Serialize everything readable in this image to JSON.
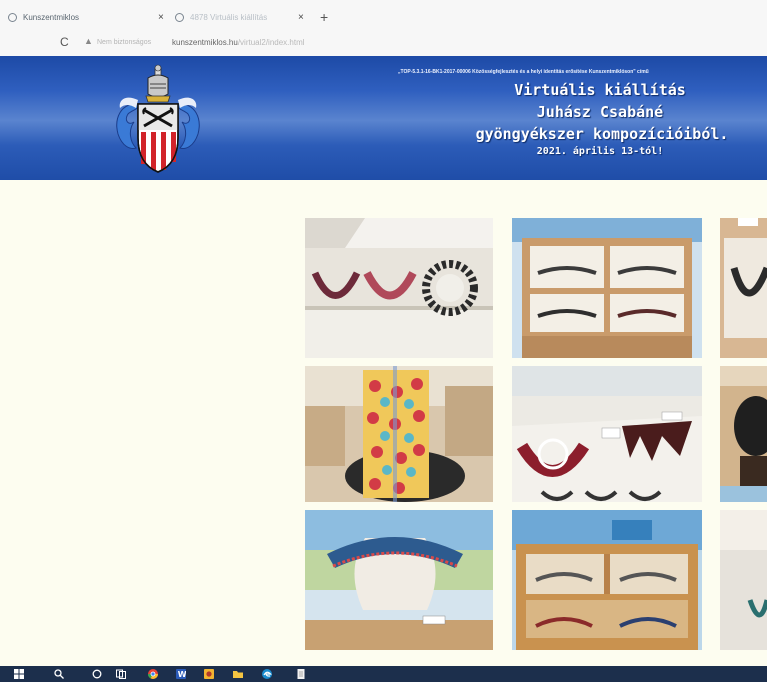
{
  "browser": {
    "tabs": [
      {
        "label": "Kunszentmiklos"
      },
      {
        "label": "4878 Virtuális kiállítás"
      }
    ],
    "new_tab": "+",
    "close": "×",
    "reload": "C",
    "security_label": "Nem biztonságos",
    "url_domain": "kunszentmiklos.hu",
    "url_path": "/virtual2/index.html"
  },
  "banner": {
    "project_note": "„TOP-5.3.1-16-BK1-2017-00006 Közösségfejlesztés és a helyi identitás erősítése Kunszentmiklóson\" című",
    "title_line1": "Virtuális kiállítás",
    "title_line2": "Juhász Csabáné",
    "title_line3": "gyöngyékszer kompozícióiból.",
    "date_line": "2021. április 13-tól!"
  },
  "gallery": {
    "photos": [
      {
        "name": "photo-necklaces-on-shelf"
      },
      {
        "name": "photo-open-cabinet-necklaces"
      },
      {
        "name": "photo-necklace-on-wall"
      },
      {
        "name": "photo-beaded-scarf-on-bust"
      },
      {
        "name": "photo-collars-in-showcase"
      },
      {
        "name": "photo-collar-on-bust-right"
      },
      {
        "name": "photo-collar-on-vase"
      },
      {
        "name": "photo-wooden-showcase"
      },
      {
        "name": "photo-showcase-right"
      }
    ]
  },
  "taskbar": {
    "icons": [
      "windows-start-icon",
      "search-icon",
      "cortana-icon",
      "task-view-icon",
      "chrome-icon",
      "word-icon",
      "explorer-icon",
      "file-folder-icon",
      "edge-icon",
      "notepad-icon"
    ]
  },
  "colors": {
    "banner_blue": "#2a5ab8",
    "page_background": "#fdfdf0",
    "taskbar": "#1c2f4c"
  }
}
